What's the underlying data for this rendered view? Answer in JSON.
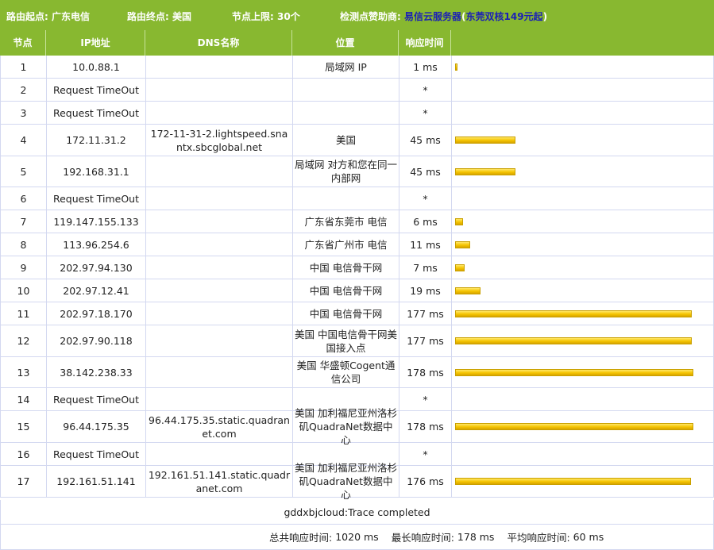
{
  "topbar": {
    "origin_label": "路由起点:",
    "origin_value": "广东电信",
    "dest_label": "路由终点:",
    "dest_value": "美国",
    "limit_label": "节点上限:",
    "limit_value": "30个",
    "sponsor_label": "检测点赞助商:",
    "sponsor_link": "易信云服务器",
    "sponsor_open": "(",
    "sponsor_link2": "东莞双核149元起",
    "sponsor_close": ")"
  },
  "columns": [
    "节点",
    "IP地址",
    "DNS名称",
    "位置",
    "响应时间",
    ""
  ],
  "max_time_ms": 178,
  "rows": [
    {
      "node": "1",
      "ip": "10.0.88.1",
      "dns": "",
      "location": "局域网 IP",
      "time": "1 ms",
      "ms": 1
    },
    {
      "node": "2",
      "ip": "Request TimeOut",
      "dns": "",
      "location": "",
      "time": "*",
      "ms": 0
    },
    {
      "node": "3",
      "ip": "Request TimeOut",
      "dns": "",
      "location": "",
      "time": "*",
      "ms": 0
    },
    {
      "node": "4",
      "ip": "172.11.31.2",
      "dns": "172-11-31-2.lightspeed.snantx.sbcglobal.net",
      "location": "美国",
      "time": "45 ms",
      "ms": 45
    },
    {
      "node": "5",
      "ip": "192.168.31.1",
      "dns": "",
      "location": "局域网 对方和您在同一内部网",
      "time": "45 ms",
      "ms": 45
    },
    {
      "node": "6",
      "ip": "Request TimeOut",
      "dns": "",
      "location": "",
      "time": "*",
      "ms": 0
    },
    {
      "node": "7",
      "ip": "119.147.155.133",
      "dns": "",
      "location": "广东省东莞市 电信",
      "time": "6 ms",
      "ms": 6
    },
    {
      "node": "8",
      "ip": "113.96.254.6",
      "dns": "",
      "location": "广东省广州市 电信",
      "time": "11 ms",
      "ms": 11
    },
    {
      "node": "9",
      "ip": "202.97.94.130",
      "dns": "",
      "location": "中国 电信骨干网",
      "time": "7 ms",
      "ms": 7
    },
    {
      "node": "10",
      "ip": "202.97.12.41",
      "dns": "",
      "location": "中国 电信骨干网",
      "time": "19 ms",
      "ms": 19
    },
    {
      "node": "11",
      "ip": "202.97.18.170",
      "dns": "",
      "location": "中国 电信骨干网",
      "time": "177 ms",
      "ms": 177
    },
    {
      "node": "12",
      "ip": "202.97.90.118",
      "dns": "",
      "location": "美国 中国电信骨干网美国接入点",
      "time": "177 ms",
      "ms": 177
    },
    {
      "node": "13",
      "ip": "38.142.238.33",
      "dns": "",
      "location": "美国 华盛顿Cogent通信公司",
      "time": "178 ms",
      "ms": 178
    },
    {
      "node": "14",
      "ip": "Request TimeOut",
      "dns": "",
      "location": "",
      "time": "*",
      "ms": 0
    },
    {
      "node": "15",
      "ip": "96.44.175.35",
      "dns": "96.44.175.35.static.quadranet.com",
      "location": "美国 加利福尼亚州洛杉矶QuadraNet数据中心",
      "time": "178 ms",
      "ms": 178
    },
    {
      "node": "16",
      "ip": "Request TimeOut",
      "dns": "",
      "location": "",
      "time": "*",
      "ms": 0
    },
    {
      "node": "17",
      "ip": "192.161.51.141",
      "dns": "192.161.51.141.static.quadranet.com",
      "location": "美国 加利福尼亚州洛杉矶QuadraNet数据中心",
      "time": "176 ms",
      "ms": 176
    }
  ],
  "footer": {
    "trace_status": "gddxbjcloud:Trace completed",
    "total_label": "总共响应时间:",
    "total_value": "1020 ms",
    "max_label": "最长响应时间:",
    "max_value": "178 ms",
    "avg_label": "平均响应时间:",
    "avg_value": "60 ms"
  },
  "colors": {
    "header_green": "#88b830",
    "bar_yellow": "#f5c400",
    "link_blue": "#1b1fb6",
    "grid_line": "#d3d8f0"
  }
}
